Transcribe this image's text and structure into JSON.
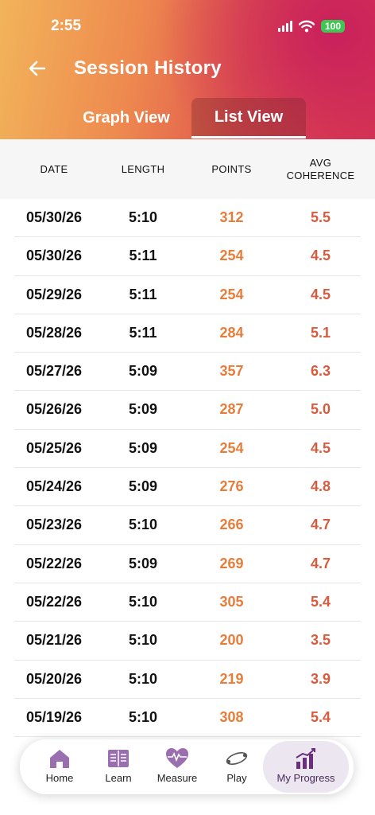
{
  "status_bar": {
    "time": "2:55",
    "battery": "100"
  },
  "header": {
    "title": "Session History",
    "back_icon": "arrow-left-icon"
  },
  "tabs": [
    {
      "label": "Graph View",
      "active": false
    },
    {
      "label": "List View",
      "active": true
    }
  ],
  "table": {
    "columns": [
      "DATE",
      "LENGTH",
      "POINTS",
      "AVG\nCOHERENCE"
    ],
    "rows": [
      {
        "date": "05/30/26",
        "length": "5:10",
        "points": "312",
        "coherence": "5.5"
      },
      {
        "date": "05/30/26",
        "length": "5:11",
        "points": "254",
        "coherence": "4.5"
      },
      {
        "date": "05/29/26",
        "length": "5:11",
        "points": "254",
        "coherence": "4.5"
      },
      {
        "date": "05/28/26",
        "length": "5:11",
        "points": "284",
        "coherence": "5.1"
      },
      {
        "date": "05/27/26",
        "length": "5:09",
        "points": "357",
        "coherence": "6.3"
      },
      {
        "date": "05/26/26",
        "length": "5:09",
        "points": "287",
        "coherence": "5.0"
      },
      {
        "date": "05/25/26",
        "length": "5:09",
        "points": "254",
        "coherence": "4.5"
      },
      {
        "date": "05/24/26",
        "length": "5:09",
        "points": "276",
        "coherence": "4.8"
      },
      {
        "date": "05/23/26",
        "length": "5:10",
        "points": "266",
        "coherence": "4.7"
      },
      {
        "date": "05/22/26",
        "length": "5:09",
        "points": "269",
        "coherence": "4.7"
      },
      {
        "date": "05/22/26",
        "length": "5:10",
        "points": "305",
        "coherence": "5.4"
      },
      {
        "date": "05/21/26",
        "length": "5:10",
        "points": "200",
        "coherence": "3.5"
      },
      {
        "date": "05/20/26",
        "length": "5:10",
        "points": "219",
        "coherence": "3.9"
      },
      {
        "date": "05/19/26",
        "length": "5:10",
        "points": "308",
        "coherence": "5.4"
      }
    ]
  },
  "nav": {
    "home": "Home",
    "learn": "Learn",
    "measure": "Measure",
    "play": "Play",
    "progress": "My Progress"
  },
  "colors": {
    "accent_orange": "#e77d3a",
    "accent_red": "#d95b3e",
    "nav_icon_purple": "#9a6fb0",
    "nav_active_bg": "#ebe6f0"
  }
}
